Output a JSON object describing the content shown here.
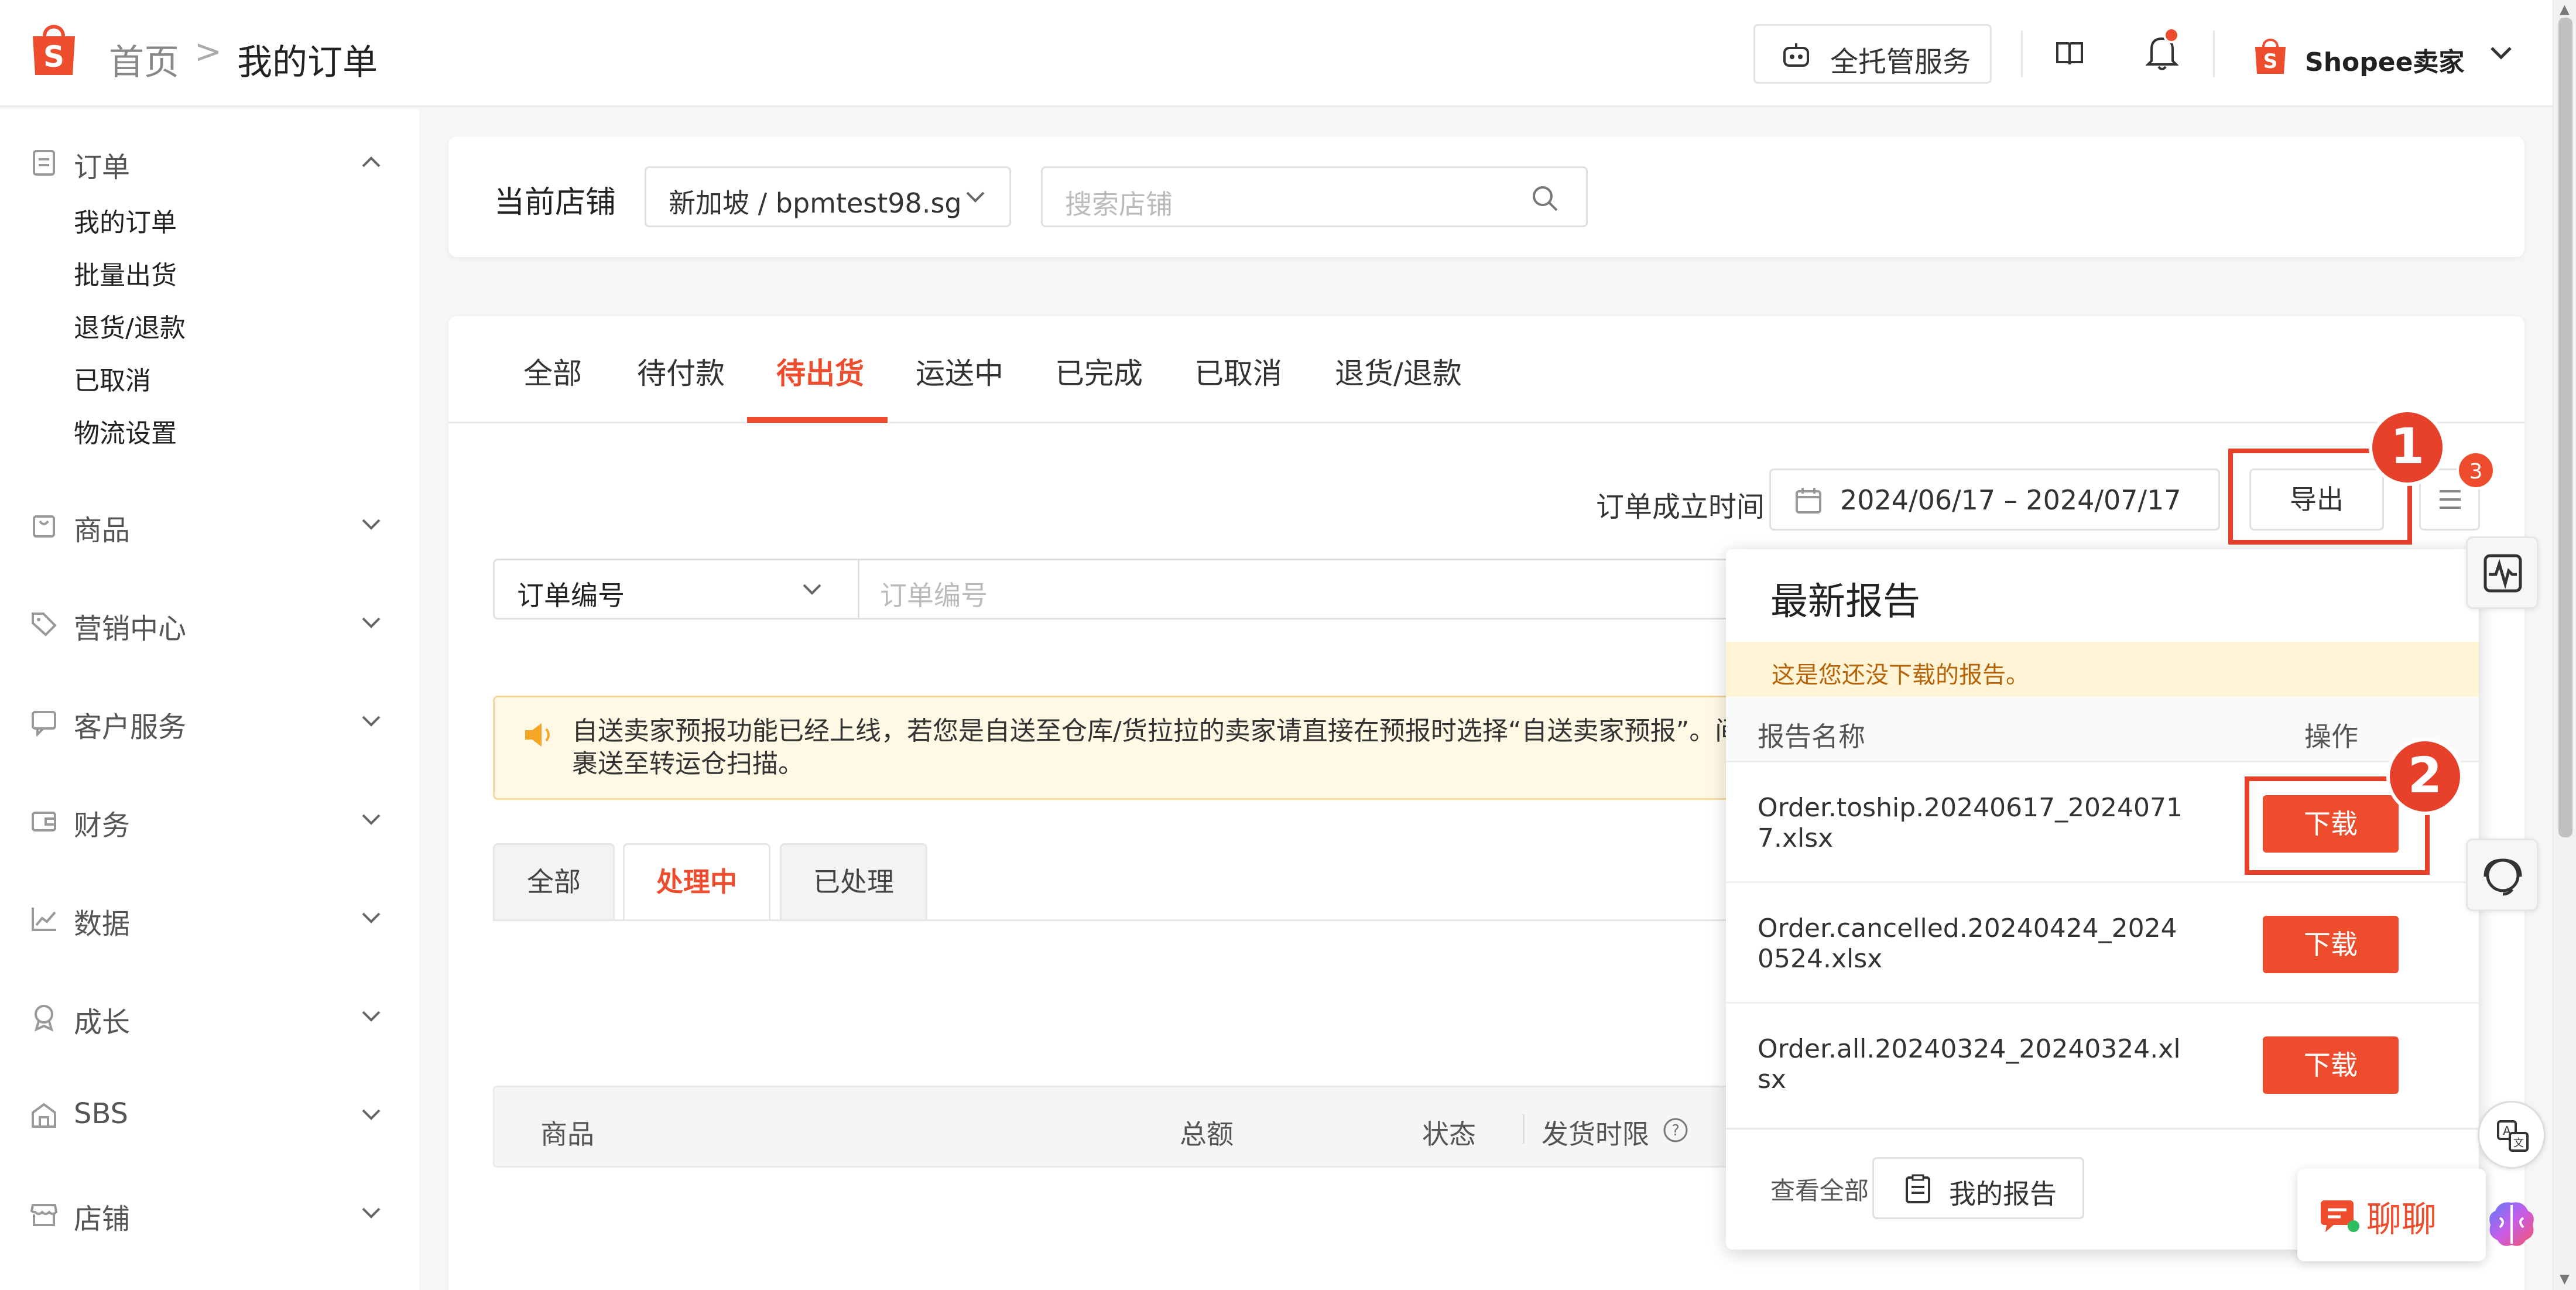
{
  "header": {
    "breadcrumb_home": "首页",
    "breadcrumb_sep": ">",
    "breadcrumb_current": "我的订单",
    "managed_service_label": "全托管服务",
    "seller_name": "Shopee卖家"
  },
  "sidebar": {
    "groups": [
      {
        "label": "订单",
        "icon": "clipboard-icon",
        "expanded": true
      },
      {
        "label": "商品",
        "icon": "bag-icon"
      },
      {
        "label": "营销中心",
        "icon": "tag-icon"
      },
      {
        "label": "客户服务",
        "icon": "chat-icon"
      },
      {
        "label": "财务",
        "icon": "wallet-icon"
      },
      {
        "label": "数据",
        "icon": "chart-icon"
      },
      {
        "label": "成长",
        "icon": "badge-icon"
      },
      {
        "label": "SBS",
        "icon": "warehouse-icon"
      },
      {
        "label": "店铺",
        "icon": "shop-icon"
      }
    ],
    "order_subitems": [
      "我的订单",
      "批量出货",
      "退货/退款",
      "已取消",
      "物流设置"
    ]
  },
  "shop": {
    "label": "当前店铺",
    "selected": "新加坡 / bpmtest98.sg",
    "search_placeholder": "搜索店铺"
  },
  "orders": {
    "tabs": [
      "全部",
      "待付款",
      "待出货",
      "运送中",
      "已完成",
      "已取消",
      "退货/退款"
    ],
    "active_tab": "待出货",
    "date_label": "订单成立时间",
    "date_range": "2024/06/17 – 2024/07/17",
    "export_label": "导出",
    "list_badge_count": "3",
    "search_type": "订单编号",
    "search_placeholder": "订单编号",
    "notice_text": "自送卖家预报功能已经上线，若您是自送至仓库/货拉拉的卖家请直接在预报时选择“自送卖家预报”。间内将包裹送至转运仓扫描。",
    "sub_tabs": [
      "全部",
      "处理中",
      "已处理"
    ],
    "active_sub_tab": "处理中",
    "columns": [
      "商品",
      "总额",
      "状态",
      "发货时限"
    ]
  },
  "report": {
    "title": "最新报告",
    "banner": "这是您还没下载的报告。",
    "col_name": "报告名称",
    "col_action": "操作",
    "rows": [
      {
        "file": "Order.toship.20240617_20240717.xlsx",
        "action": "下载"
      },
      {
        "file": "Order.cancelled.20240424_20240524.xlsx",
        "action": "下载"
      },
      {
        "file": "Order.all.20240324_20240324.xlsx",
        "action": "下载"
      }
    ],
    "view_all": "查看全部",
    "my_reports": "我的报告"
  },
  "callouts": [
    "1",
    "2"
  ],
  "chat": {
    "label": "聊聊"
  },
  "colors": {
    "brand": "#ee4d2d",
    "callout": "#e8412b",
    "notice_bg": "#fff8e5"
  }
}
